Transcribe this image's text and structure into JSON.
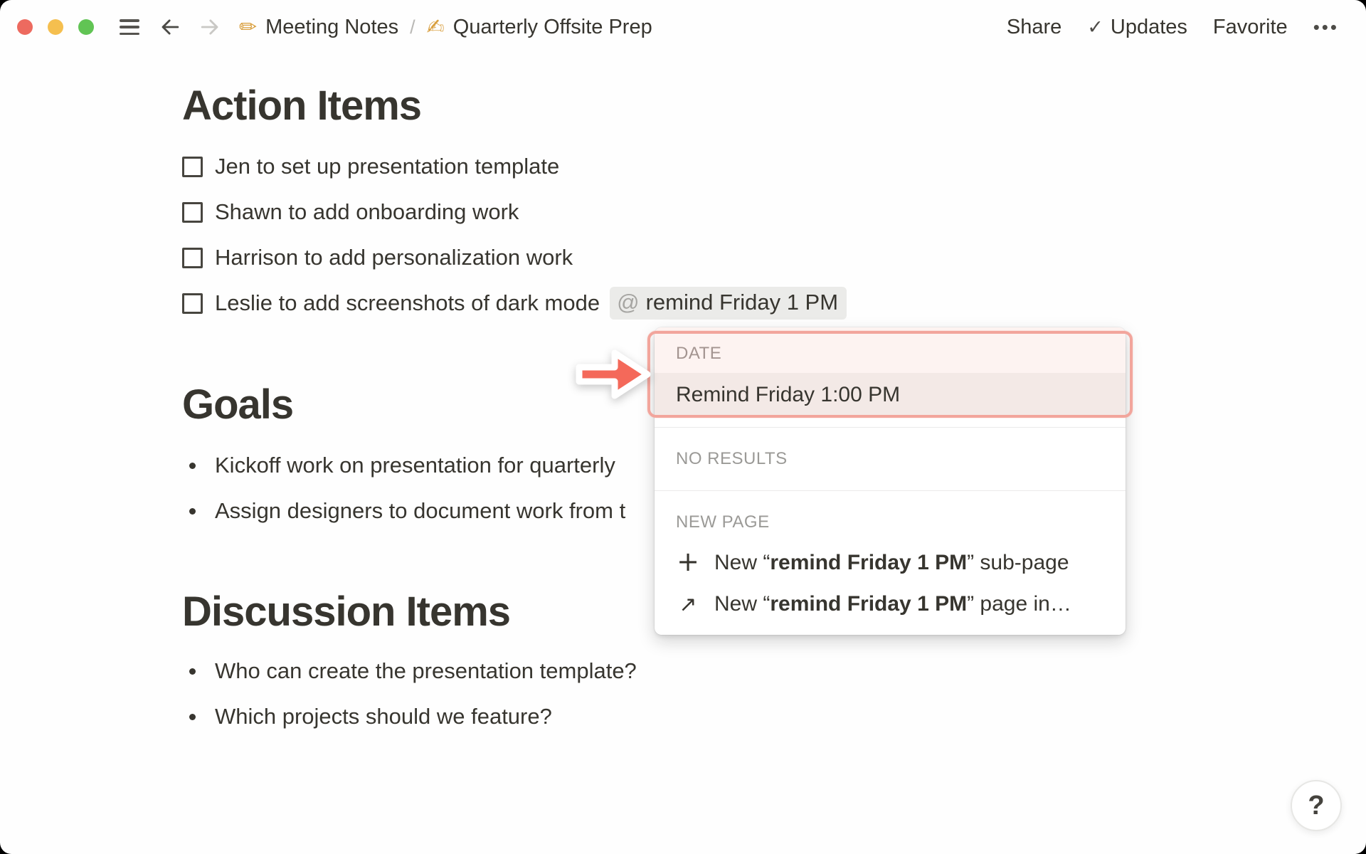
{
  "topbar": {
    "breadcrumb": {
      "page1_icon": "✏",
      "page1": "Meeting Notes",
      "separator": "/",
      "page2_icon": "✍",
      "page2": "Quarterly Offsite Prep"
    },
    "actions": {
      "share": "Share",
      "updates_check_icon": "✓",
      "updates": "Updates",
      "favorite": "Favorite",
      "more_icon": "•••"
    }
  },
  "content": {
    "action_items": {
      "heading": "Action Items",
      "todos": [
        {
          "text": "Jen to set up presentation template",
          "checked": false
        },
        {
          "text": "Shawn to add onboarding work",
          "checked": false
        },
        {
          "text": "Harrison to add personalization work",
          "checked": false
        },
        {
          "text": "Leslie to add screenshots of dark mode",
          "checked": false,
          "mention": {
            "at": "@",
            "text": "remind Friday 1 PM"
          }
        }
      ]
    },
    "goals": {
      "heading": "Goals",
      "bullets": [
        "Kickoff work on presentation for quarterly",
        "Assign designers to document work from t"
      ]
    },
    "discussion": {
      "heading": "Discussion Items",
      "bullets": [
        "Who can create the presentation template?",
        "Which projects should we feature?"
      ]
    }
  },
  "popup": {
    "date_section_label": "DATE",
    "date_result": "Remind Friday 1:00 PM",
    "no_results_label": "NO RESULTS",
    "new_page_label": "NEW PAGE",
    "new_subpage": {
      "icon": "+",
      "prefix": "New “",
      "query": "remind Friday 1 PM",
      "suffix": "” sub-page"
    },
    "new_page_in": {
      "icon": "↗",
      "prefix": "New “",
      "query": "remind Friday 1 PM",
      "suffix": "” page in…"
    }
  },
  "help": {
    "label": "?"
  },
  "colors": {
    "accent_arrow": "#f4695a",
    "highlight_ring": "#f2a59c",
    "date_zone_bg": "#fdf3f1",
    "selected_row_bg": "#f3e9e6",
    "mention_bg": "#ebebe9",
    "text": "#37352f"
  }
}
